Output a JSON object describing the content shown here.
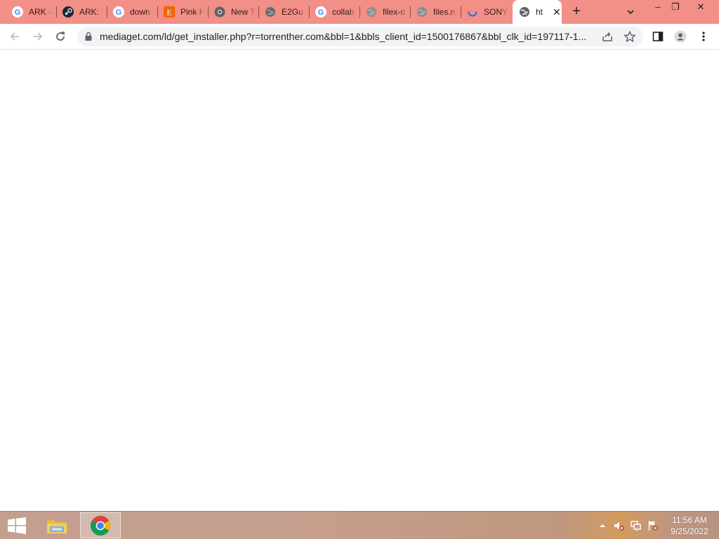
{
  "browser": {
    "tabs": [
      {
        "title": "ARK -",
        "icon": "google-icon"
      },
      {
        "title": "ARK: S",
        "icon": "steam-icon"
      },
      {
        "title": "down",
        "icon": "google-icon"
      },
      {
        "title": "Pink H",
        "icon": "etsy-icon"
      },
      {
        "title": "New T",
        "icon": "chrome-icon"
      },
      {
        "title": "E2Gu",
        "icon": "globe-icon"
      },
      {
        "title": "collab",
        "icon": "google-icon"
      },
      {
        "title": "filex-d",
        "icon": "globe-icon"
      },
      {
        "title": "files.n",
        "icon": "globe-icon"
      },
      {
        "title": "SONY",
        "icon": "loading-spinner-icon"
      },
      {
        "title": "ht",
        "icon": "globe-icon",
        "active": true
      }
    ],
    "close_tab_glyph": "✕",
    "new_tab_glyph": "+",
    "window_controls": {
      "minimize": "–",
      "restore": "❐",
      "close": "✕"
    },
    "url": "mediaget.com/ld/get_installer.php?r=torrenther.com&bbl=1&bbls_client_id=1500176867&bbl_clk_id=197117-1..."
  },
  "taskbar": {
    "apps": [
      {
        "name": "file-explorer",
        "active": false
      },
      {
        "name": "google-chrome",
        "active": true
      }
    ],
    "clock": {
      "time": "11:56 AM",
      "date": "9/25/2022"
    }
  },
  "colors": {
    "tab_strip": "#f28f86",
    "toolbar": "#ffffff",
    "omnibox": "#f1f3f4",
    "taskbar": "#c39f8f"
  }
}
